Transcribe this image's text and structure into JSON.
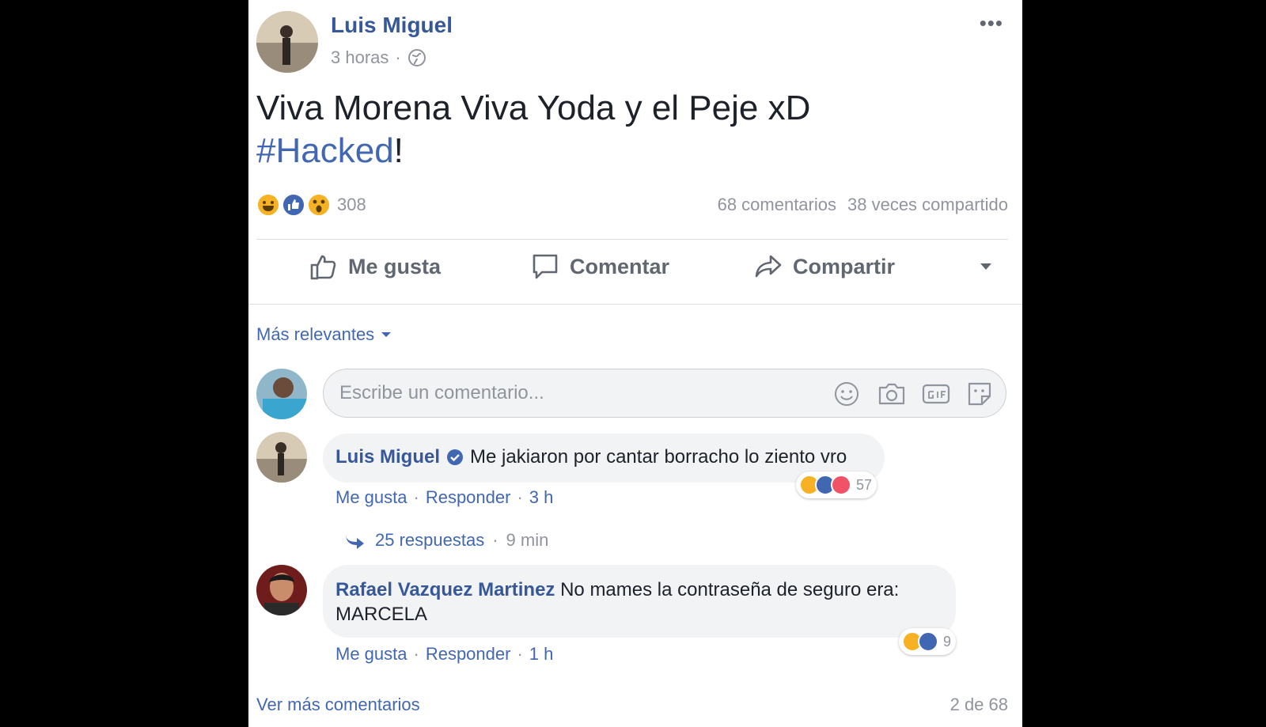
{
  "post": {
    "author": "Luis Miguel",
    "time": "3 horas",
    "more": "•••",
    "text_line1": "Viva Morena Viva Yoda y el Peje xD",
    "hashtag": "#Hacked",
    "hashtag_suffix": "!",
    "reaction_count": "308",
    "comments_count": "68 comentarios",
    "shares_count": "38 veces compartido"
  },
  "actions": {
    "like": "Me gusta",
    "comment": "Comentar",
    "share": "Compartir"
  },
  "sort_label": "Más relevantes",
  "composer": {
    "placeholder": "Escribe un comentario..."
  },
  "comments": [
    {
      "author": "Luis Miguel",
      "text": "Me jakiaron por cantar borracho lo ziento vro",
      "like": "Me gusta",
      "reply": "Responder",
      "time": "3 h",
      "reaction_count": "57",
      "replies": "25 respuestas",
      "replies_time": "9 min"
    },
    {
      "author": "Rafael Vazquez Martinez",
      "text_line1": "No mames la contraseña de seguro era:",
      "text_line2": "MARCELA",
      "like": "Me gusta",
      "reply": "Responder",
      "time": "1 h",
      "reaction_count": "9"
    }
  ],
  "footer": {
    "more_comments": "Ver más comentarios",
    "pagination": "2 de 68"
  },
  "colors": {
    "link": "#365899",
    "muted": "#90949c",
    "like_blue": "#4267b2",
    "haha_yellow": "#f7b125",
    "love_red": "#f25268"
  }
}
